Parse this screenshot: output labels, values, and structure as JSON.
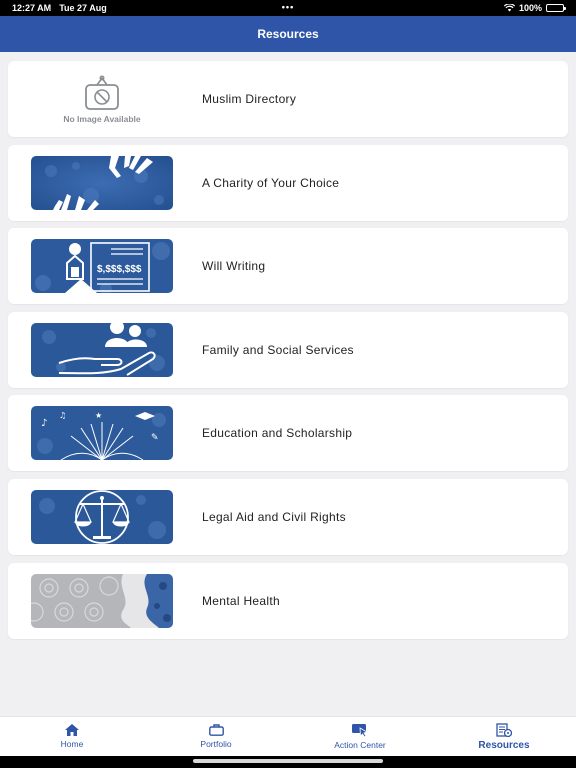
{
  "status_bar": {
    "time": "12:27 AM",
    "date": "Tue 27 Aug",
    "dots": "•••",
    "battery_pct": "100%"
  },
  "nav": {
    "title": "Resources"
  },
  "resources": [
    {
      "label": "Muslim Directory",
      "image": "none",
      "placeholder_text": "No Image Available"
    },
    {
      "label": "A Charity of Your Choice",
      "image": "hands-icon"
    },
    {
      "label": "Will Writing",
      "image": "will-document-icon"
    },
    {
      "label": "Family and Social Services",
      "image": "family-care-icon"
    },
    {
      "label": "Education and Scholarship",
      "image": "education-book-icon"
    },
    {
      "label": "Legal Aid and Civil Rights",
      "image": "scales-of-justice-icon"
    },
    {
      "label": "Mental Health",
      "image": "mental-health-pattern"
    }
  ],
  "tabs": [
    {
      "label": "Home",
      "icon": "home-icon",
      "active": false
    },
    {
      "label": "Portfolio",
      "icon": "briefcase-icon",
      "active": false
    },
    {
      "label": "Action Center",
      "icon": "action-center-icon",
      "active": false
    },
    {
      "label": "Resources",
      "icon": "resources-icon",
      "active": true
    }
  ],
  "colors": {
    "accent": "#2f55a8",
    "background": "#f0f0f2",
    "card": "#ffffff",
    "thumb_blue": "#2e5a9e"
  }
}
